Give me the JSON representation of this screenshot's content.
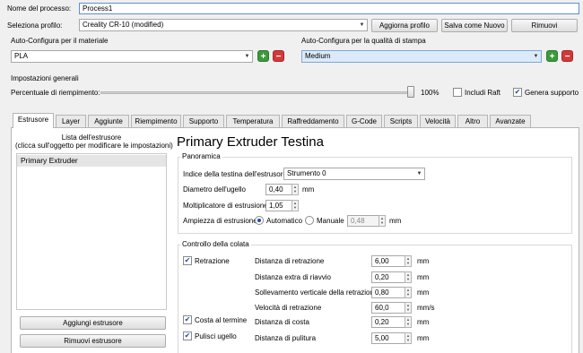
{
  "process": {
    "name_label": "Nome del processo:",
    "name_value": "Process1"
  },
  "profile": {
    "label": "Seleziona profilo:",
    "value": "Creality CR-10 (modified)",
    "update_btn": "Aggiorna profilo",
    "save_new_btn": "Salva come Nuovo",
    "remove_btn": "Rimuovi"
  },
  "material": {
    "label": "Auto-Configura per il materiale",
    "value": "PLA"
  },
  "quality": {
    "label": "Auto-Configura per la qualità di stampa",
    "value": "Medium"
  },
  "general": {
    "title": "Impostazioni generali",
    "infill_label": "Percentuale di riempimento:",
    "infill_value": "100%",
    "infill_fraction": 1.0,
    "raft_label": "Includi Raft",
    "raft_checked": false,
    "support_label": "Genera supporto",
    "support_checked": true
  },
  "tabs": [
    "Estrusore",
    "Layer",
    "Aggiunte",
    "Riempimento",
    "Supporto",
    "Temperatura",
    "Raffreddamento",
    "G-Code",
    "Scripts",
    "Velocità",
    "Altro",
    "Avanzate"
  ],
  "extruder_list": {
    "title_line1": "Lista dell'estrusore",
    "title_line2": "(clicca sull'oggetto per modificare le impostazioni)",
    "items": [
      "Primary Extruder"
    ],
    "add_btn": "Aggiungi estrusore",
    "remove_btn": "Rimuovi estrusore"
  },
  "heading": "Primary Extruder Testina",
  "overview": {
    "title": "Panoramica",
    "head_index_label": "Indice della testina dell'estrusore",
    "head_index_value": "Strumento 0",
    "nozzle_label": "Diametro dell'ugello",
    "nozzle_value": "0,40",
    "nozzle_unit": "mm",
    "multiplier_label": "Moltiplicatore di estrusione",
    "multiplier_value": "1,05",
    "width_label": "Ampiezza di estrusione",
    "auto_label": "Automatico",
    "manual_label": "Manuale",
    "width_value": "0,48",
    "width_unit": "mm"
  },
  "ooze": {
    "title": "Controllo della colata",
    "retraction_label": "Retrazione",
    "retraction_checked": true,
    "coast_label": "Costa al termine",
    "coast_checked": true,
    "wipe_label": "Pulisci ugello",
    "wipe_checked": true,
    "rows": [
      {
        "label": "Distanza di retrazione",
        "value": "6,00",
        "unit": "mm"
      },
      {
        "label": "Distanza extra di riavvio",
        "value": "0,20",
        "unit": "mm"
      },
      {
        "label": "Sollevamento verticale della retrazione",
        "value": "0,80",
        "unit": "mm"
      },
      {
        "label": "Velocità di retrazione",
        "value": "60,0",
        "unit": "mm/s"
      },
      {
        "label": "Distanza di costa",
        "value": "0,20",
        "unit": "mm"
      },
      {
        "label": "Distanza di pulitura",
        "value": "5,00",
        "unit": "mm"
      }
    ]
  },
  "colors": {
    "accent": "#1c4fa0",
    "add": "#3c9a3c",
    "remove": "#d23a3a",
    "selection": "#dbeaf9"
  }
}
